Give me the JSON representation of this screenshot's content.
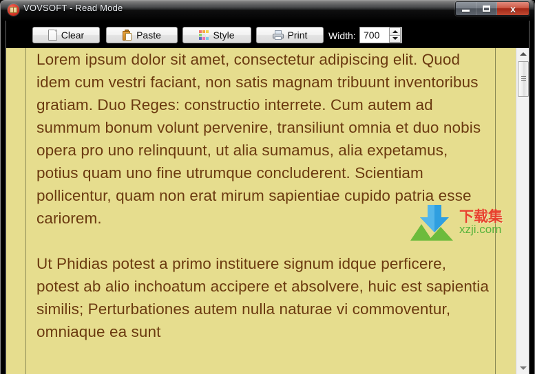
{
  "window": {
    "title": "VOVSOFT - Read Mode",
    "app_icon": "book-icon",
    "controls": {
      "minimize": "minimize-button",
      "maximize": "maximize-button",
      "close_label": "x"
    }
  },
  "toolbar": {
    "clear_label": "Clear",
    "paste_label": "Paste",
    "style_label": "Style",
    "print_label": "Print",
    "width_label": "Width:",
    "width_value": "700",
    "style_icon_colors": [
      "#f07a6e",
      "#f2a93f",
      "#f2d24a",
      "#8fd36a",
      "#e4e4e4",
      "#f0f0f0",
      "#5b6fc0",
      "#ef6fae",
      "#7ec8e8"
    ]
  },
  "reader": {
    "background_color": "#e6dd8e",
    "text_color": "#6b3a10",
    "paragraphs": [
      "Lorem ipsum dolor sit amet, consectetur adipiscing elit. Quod idem cum vestri faciant, non satis magnam tribuunt inventoribus gratiam. Duo Reges: constructio interrete. Cum autem ad summum bonum volunt pervenire, transiliunt omnia et duo nobis opera pro uno relinquunt, ut alia sumamus, alia expetamus, potius quam uno fine utrumque concluderent. Scientiam pollicentur, quam non erat mirum sapientiae cupido patria esse cariorem.",
      "Ut Phidias potest a primo instituere signum idque perficere, potest ab alio inchoatum accipere et absolvere, huic est sapientia similis; Perturbationes autem nulla naturae vi commoventur, omniaque ea sunt"
    ]
  },
  "scrollbar": {
    "up_arrow": "scroll-up-arrow",
    "down_arrow": "scroll-down-arrow"
  },
  "watermark": {
    "brand_cn": "下载集",
    "url": "xzji.com",
    "brand_color": "#e8412e",
    "url_color": "#59b33c"
  }
}
